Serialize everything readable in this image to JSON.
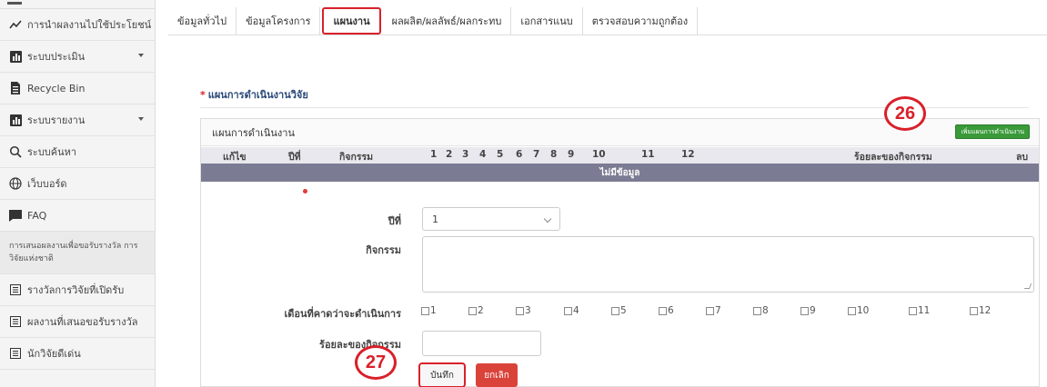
{
  "sidebar": {
    "items": [
      {
        "label": "การนำผลงานไปใช้ประโยชน์",
        "icon": "trend-line-icon"
      },
      {
        "label": "ระบบประเมิน",
        "icon": "bar-chart-icon",
        "caret": true
      },
      {
        "label": "Recycle Bin",
        "icon": "document-icon"
      },
      {
        "label": "ระบบรายงาน",
        "icon": "bar-chart-icon",
        "caret": true
      },
      {
        "label": "ระบบค้นหา",
        "icon": "search-icon"
      },
      {
        "label": "เว็บบอร์ด",
        "icon": "globe-icon"
      },
      {
        "label": "FAQ",
        "icon": "message-icon"
      }
    ],
    "section_label": "การเสนอผลงานเพื่อขอรับรางวัล การวิจัยแห่งชาติ",
    "sub_items": [
      {
        "label": "รางวัลการวิจัยที่เปิดรับ",
        "icon": "list-icon"
      },
      {
        "label": "ผลงานที่เสนอขอรับรางวัล",
        "icon": "list-icon"
      },
      {
        "label": "นักวิจัยดีเด่น",
        "icon": "list-icon"
      }
    ]
  },
  "tabs": [
    "ข้อมูลทั่วไป",
    "ข้อมูลโครงการ",
    "แผนงาน",
    "ผลผลิต/ผลลัพธ์/ผลกระทบ",
    "เอกสารแนบ",
    "ตรวจสอบความถูกต้อง"
  ],
  "active_tab": "แผนงาน",
  "section": {
    "required_mark": "*",
    "title": "แผนการดำเนินงานวิจัย"
  },
  "panel": {
    "title": "แผนการดำเนินงาน",
    "add_button": "เพิ่มแผนการดำเนินงาน",
    "columns": [
      "แก้ไข",
      "ปีที่",
      "กิจกรรม",
      "1",
      "2",
      "3",
      "4",
      "5",
      "6",
      "7",
      "8",
      "9",
      "10",
      "11",
      "12",
      "ร้อยละของกิจกรรม",
      "ลบ"
    ],
    "empty_text": "ไม่มีข้อมูล"
  },
  "form": {
    "year_label": "ปีที่",
    "year_value": "1",
    "activity_label": "กิจกรรม",
    "months_label": "เดือนที่คาดว่าจะดำเนินการ",
    "months": [
      "1",
      "2",
      "3",
      "4",
      "5",
      "6",
      "7",
      "8",
      "9",
      "10",
      "11",
      "12"
    ],
    "percent_label": "ร้อยละของกิจกรรม",
    "save_label": "บันทึก",
    "cancel_label": "ยกเลิก"
  },
  "annotations": {
    "badge_add": "26",
    "badge_save": "27"
  },
  "colors": {
    "highlight": "#d9202a",
    "add_button": "#3a9a3a",
    "nodata_bar": "#7b7b93",
    "cancel": "#d9433a"
  }
}
